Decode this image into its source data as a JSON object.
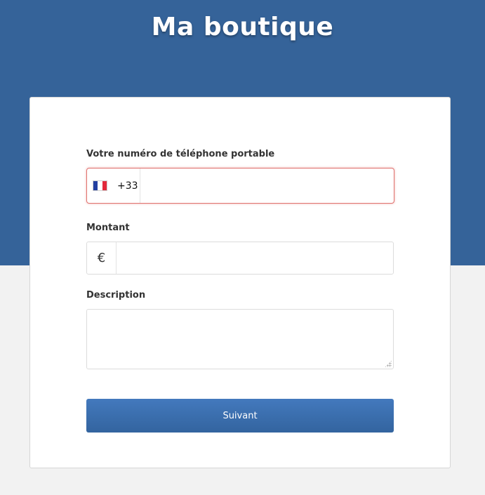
{
  "header": {
    "title": "Ma boutique"
  },
  "form": {
    "phone": {
      "label": "Votre numéro de téléphone portable",
      "country_flag": "france-flag-icon",
      "dial_code": "+33",
      "value": "",
      "status": "error"
    },
    "amount": {
      "label": "Montant",
      "currency_symbol": "€",
      "value": ""
    },
    "description": {
      "label": "Description",
      "value": ""
    },
    "submit_label": "Suivant"
  },
  "colors": {
    "header_background": "#356399",
    "page_background": "#f2f2f2",
    "button_background": "#3b6fae",
    "error_border": "#e0726f"
  }
}
